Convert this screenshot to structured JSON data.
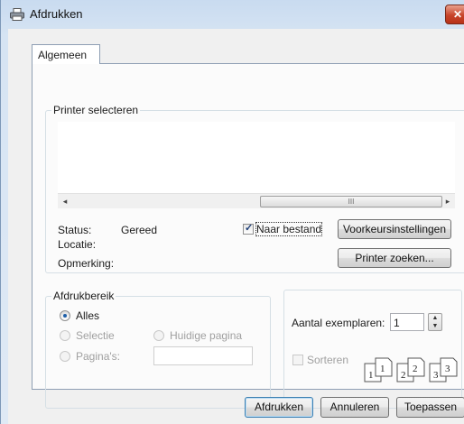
{
  "window": {
    "title": "Afdrukken",
    "close_label": "✕"
  },
  "tabs": [
    {
      "label": "Algemeen",
      "selected": true
    }
  ],
  "printer_select": {
    "group_label": "Printer selecteren",
    "scrollbar_grip": "III",
    "status_label": "Status:",
    "status_value": "Gereed",
    "location_label": "Locatie:",
    "location_value": "",
    "comment_label": "Opmerking:",
    "comment_value": "",
    "print_to_file_label": "Naar bestand",
    "print_to_file_checked": true,
    "preferences_button": "Voorkeursinstellingen",
    "find_printer_button": "Printer zoeken..."
  },
  "page_range": {
    "group_label": "Afdrukbereik",
    "all_label": "Alles",
    "selection_label": "Selectie",
    "current_page_label": "Huidige pagina",
    "pages_label": "Pagina's:",
    "pages_value": "",
    "selected": "Alles"
  },
  "copies": {
    "label": "Aantal exemplaren:",
    "value": "1",
    "collate_label": "Sorteren",
    "collate_checked": false,
    "collate_pages": [
      "1",
      "1",
      "2",
      "2",
      "3",
      "3"
    ]
  },
  "footer": {
    "print_button": "Afdrukken",
    "cancel_button": "Annuleren",
    "apply_button": "Toepassen"
  }
}
